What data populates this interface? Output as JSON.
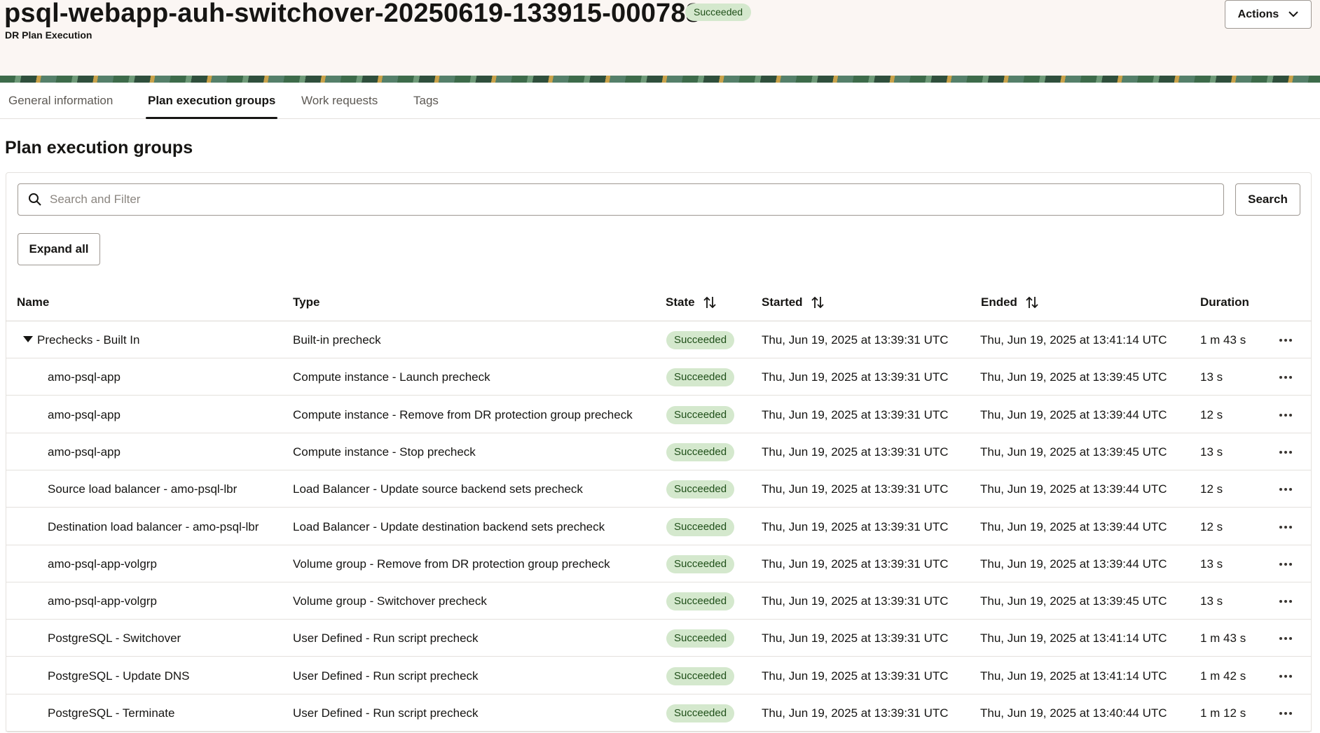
{
  "header": {
    "title": "psql-webapp-auh-switchover-20250619-133915-000788",
    "subtitle": "DR Plan Execution",
    "status": "Succeeded",
    "actions_label": "Actions",
    "actions_icon": "chevron-down-icon"
  },
  "tabs": [
    {
      "label": "General information",
      "active": false
    },
    {
      "label": "Plan execution groups",
      "active": true
    },
    {
      "label": "Work requests",
      "active": false
    },
    {
      "label": "Tags",
      "active": false
    }
  ],
  "section": {
    "title": "Plan execution groups"
  },
  "search": {
    "placeholder": "Search and Filter",
    "value": "",
    "button_label": "Search"
  },
  "expand_all_label": "Expand all",
  "columns": {
    "name": "Name",
    "type": "Type",
    "state": "State",
    "started": "Started",
    "ended": "Ended",
    "duration": "Duration"
  },
  "rows": [
    {
      "name": "Prechecks - Built In",
      "type": "Built-in precheck",
      "state": "Succeeded",
      "started": "Thu, Jun 19, 2025 at 13:39:31 UTC",
      "ended": "Thu, Jun 19, 2025 at 13:41:14 UTC",
      "duration": "1 m 43 s",
      "group": true
    },
    {
      "name": "amo-psql-app",
      "type": "Compute instance - Launch precheck",
      "state": "Succeeded",
      "started": "Thu, Jun 19, 2025 at 13:39:31 UTC",
      "ended": "Thu, Jun 19, 2025 at 13:39:45 UTC",
      "duration": "13 s",
      "group": false
    },
    {
      "name": "amo-psql-app",
      "type": "Compute instance - Remove from DR protection group precheck",
      "state": "Succeeded",
      "started": "Thu, Jun 19, 2025 at 13:39:31 UTC",
      "ended": "Thu, Jun 19, 2025 at 13:39:44 UTC",
      "duration": "12 s",
      "group": false
    },
    {
      "name": "amo-psql-app",
      "type": "Compute instance - Stop precheck",
      "state": "Succeeded",
      "started": "Thu, Jun 19, 2025 at 13:39:31 UTC",
      "ended": "Thu, Jun 19, 2025 at 13:39:45 UTC",
      "duration": "13 s",
      "group": false
    },
    {
      "name": "Source load balancer - amo-psql-lbr",
      "type": "Load Balancer - Update source backend sets precheck",
      "state": "Succeeded",
      "started": "Thu, Jun 19, 2025 at 13:39:31 UTC",
      "ended": "Thu, Jun 19, 2025 at 13:39:44 UTC",
      "duration": "12 s",
      "group": false
    },
    {
      "name": "Destination load balancer - amo-psql-lbr",
      "type": "Load Balancer - Update destination backend sets precheck",
      "state": "Succeeded",
      "started": "Thu, Jun 19, 2025 at 13:39:31 UTC",
      "ended": "Thu, Jun 19, 2025 at 13:39:44 UTC",
      "duration": "12 s",
      "group": false
    },
    {
      "name": "amo-psql-app-volgrp",
      "type": "Volume group - Remove from DR protection group precheck",
      "state": "Succeeded",
      "started": "Thu, Jun 19, 2025 at 13:39:31 UTC",
      "ended": "Thu, Jun 19, 2025 at 13:39:44 UTC",
      "duration": "13 s",
      "group": false
    },
    {
      "name": "amo-psql-app-volgrp",
      "type": "Volume group - Switchover precheck",
      "state": "Succeeded",
      "started": "Thu, Jun 19, 2025 at 13:39:31 UTC",
      "ended": "Thu, Jun 19, 2025 at 13:39:45 UTC",
      "duration": "13 s",
      "group": false
    },
    {
      "name": "PostgreSQL - Switchover",
      "type": "User Defined - Run script precheck",
      "state": "Succeeded",
      "started": "Thu, Jun 19, 2025 at 13:39:31 UTC",
      "ended": "Thu, Jun 19, 2025 at 13:41:14 UTC",
      "duration": "1 m 43 s",
      "group": false
    },
    {
      "name": "PostgreSQL - Update DNS",
      "type": "User Defined - Run script precheck",
      "state": "Succeeded",
      "started": "Thu, Jun 19, 2025 at 13:39:31 UTC",
      "ended": "Thu, Jun 19, 2025 at 13:41:14 UTC",
      "duration": "1 m 42 s",
      "group": false
    },
    {
      "name": "PostgreSQL - Terminate",
      "type": "User Defined - Run script precheck",
      "state": "Succeeded",
      "started": "Thu, Jun 19, 2025 at 13:39:31 UTC",
      "ended": "Thu, Jun 19, 2025 at 13:40:44 UTC",
      "duration": "1 m 12 s",
      "group": false
    }
  ],
  "colors": {
    "success_bg": "#d4e8cd",
    "success_text": "#1f4f19",
    "header_bg": "#fbf6f3"
  }
}
